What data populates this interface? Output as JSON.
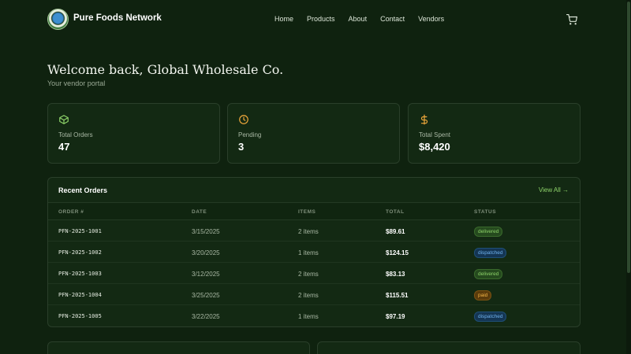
{
  "brand": {
    "name": "Pure Foods Network"
  },
  "nav": [
    "Home",
    "Products",
    "About",
    "Contact",
    "Vendors"
  ],
  "welcome": {
    "title": "Welcome back, Global Wholesale Co.",
    "subtitle": "Your vendor portal"
  },
  "stats": [
    {
      "icon": "box-icon",
      "label": "Total Orders",
      "value": "47",
      "color": "#8ed36a"
    },
    {
      "icon": "clock-icon",
      "label": "Pending",
      "value": "3",
      "color": "#f2a93b"
    },
    {
      "icon": "dollar-icon",
      "label": "Total Spent",
      "value": "$8,420",
      "color": "#f2a93b"
    }
  ],
  "recent_orders": {
    "title": "Recent Orders",
    "view_all": "View All →",
    "columns": [
      "ORDER #",
      "DATE",
      "ITEMS",
      "TOTAL",
      "STATUS"
    ],
    "rows": [
      {
        "order": "PFN-2025-1001",
        "date": "3/15/2025",
        "items": "2 items",
        "total": "$89.61",
        "status": "delivered"
      },
      {
        "order": "PFN-2025-1002",
        "date": "3/20/2025",
        "items": "1 items",
        "total": "$124.15",
        "status": "dispatched"
      },
      {
        "order": "PFN-2025-1003",
        "date": "3/12/2025",
        "items": "2 items",
        "total": "$83.13",
        "status": "delivered"
      },
      {
        "order": "PFN-2025-1004",
        "date": "3/25/2025",
        "items": "2 items",
        "total": "$115.51",
        "status": "paid"
      },
      {
        "order": "PFN-2025-1005",
        "date": "3/22/2025",
        "items": "1 items",
        "total": "$97.19",
        "status": "dispatched"
      }
    ]
  },
  "colors": {
    "background": "#0f220f",
    "accent": "#8ed36a",
    "card": "#132913"
  }
}
